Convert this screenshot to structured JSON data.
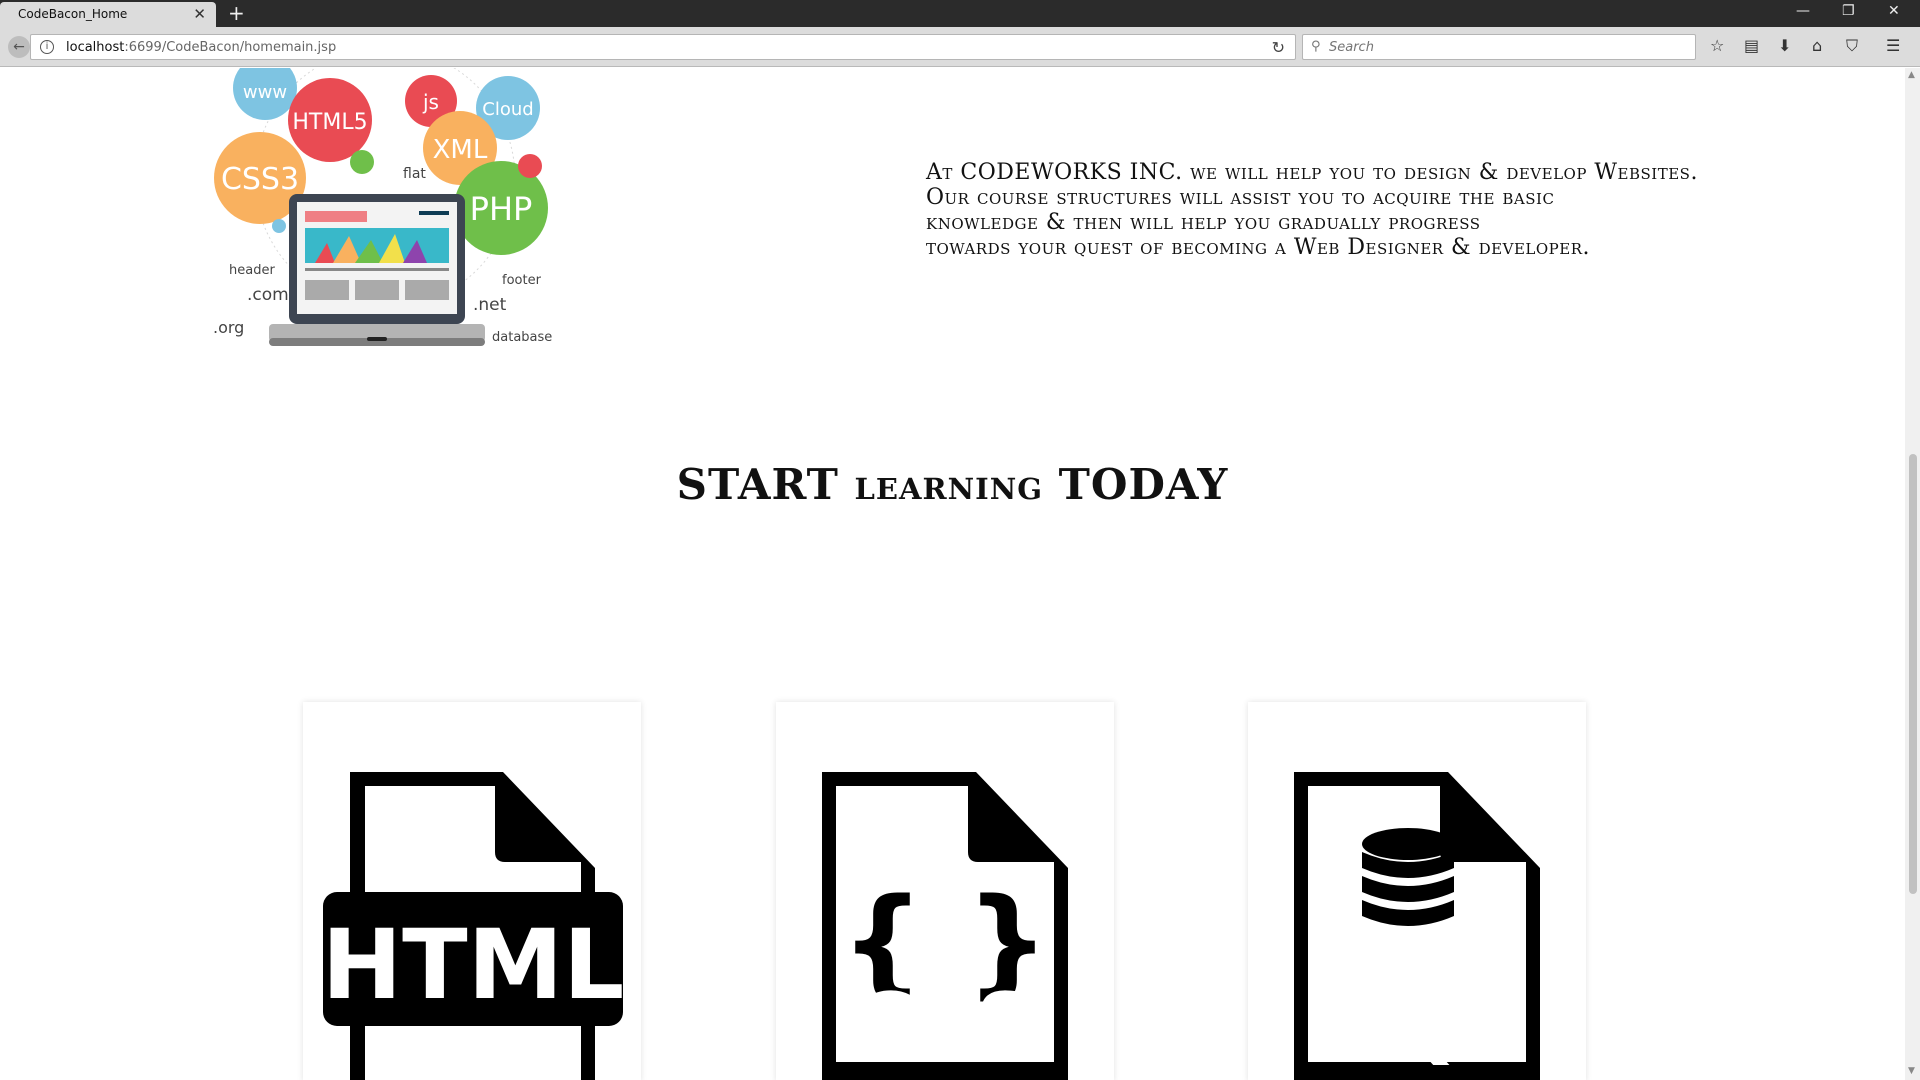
{
  "browser": {
    "tab_title": "CodeBacon_Home",
    "url_host": "localhost",
    "url_path": ":6699/CodeBacon/homemain.jsp",
    "search_placeholder": "Search"
  },
  "hero": {
    "image_labels": {
      "www": "www",
      "html5": "HTML5",
      "js": "js",
      "cloud": "Cloud",
      "css3": "CSS3",
      "xml": "XML",
      "flat": "flat",
      "php": "PHP",
      "header": "header",
      "com": ".com",
      "footer": "footer",
      "net": ".net",
      "org": ".org",
      "database": "database"
    },
    "lines": [
      "At CODEWORKS INC. we will help you to design & develop Websites.",
      "Our course structures will assist you to acquire the basic",
      "knowledge & then will help you gradually progress",
      "towards your quest of becoming a Web Designer & developer."
    ]
  },
  "section": {
    "title": "START learning TODAY"
  },
  "cards": [
    {
      "label": "HTML",
      "icon": "html-file-icon"
    },
    {
      "label": "CSS",
      "icon": "css-file-icon"
    },
    {
      "label": "SQL",
      "icon": "sql-file-icon"
    }
  ],
  "colors": {
    "html5": "#e94b53",
    "css3": "#f9b15f",
    "php": "#6fbf4a",
    "cloud": "#7ec4e2",
    "chrome_dark": "#2b2b2b",
    "chrome_light": "#dcdcdc"
  }
}
